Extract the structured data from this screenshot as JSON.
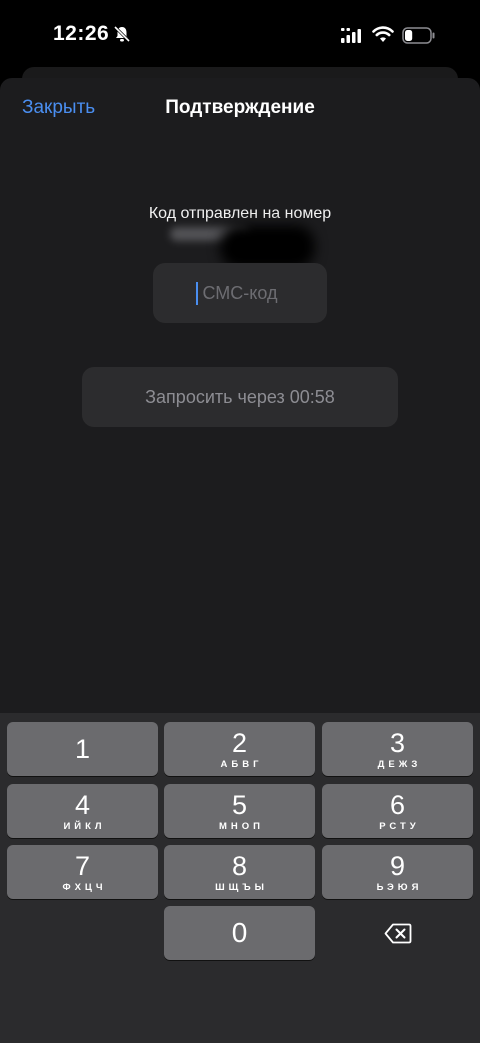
{
  "status_bar": {
    "time": "12:26",
    "icons": [
      "bell-slash-icon",
      "signal-icon",
      "wifi-icon",
      "battery-icon"
    ],
    "battery_level": 0.3
  },
  "header": {
    "close_label": "Закрыть",
    "title": "Подтверждение"
  },
  "main": {
    "sent_label": "Код отправлен на номер",
    "sms_input": {
      "placeholder": "СМС-код",
      "value": ""
    },
    "resend_label": "Запросить через 00:58"
  },
  "keypad": {
    "keys": [
      {
        "digit": "1",
        "letters": ""
      },
      {
        "digit": "2",
        "letters": "АБВГ"
      },
      {
        "digit": "3",
        "letters": "ДЕЖЗ"
      },
      {
        "digit": "4",
        "letters": "ИЙКЛ"
      },
      {
        "digit": "5",
        "letters": "МНОП"
      },
      {
        "digit": "6",
        "letters": "РСТУ"
      },
      {
        "digit": "7",
        "letters": "ФХЦЧ"
      },
      {
        "digit": "8",
        "letters": "ШЩЪЫ"
      },
      {
        "digit": "9",
        "letters": "ЬЭЮЯ"
      },
      {
        "digit": "0",
        "letters": ""
      }
    ],
    "backspace_icon": "delete-left-icon"
  },
  "colors": {
    "accent": "#4a8ef0",
    "sheet": "#1c1c1e",
    "field": "#2c2c2e",
    "key": "#6b6b6e",
    "keyboard": "#2b2b2d"
  }
}
